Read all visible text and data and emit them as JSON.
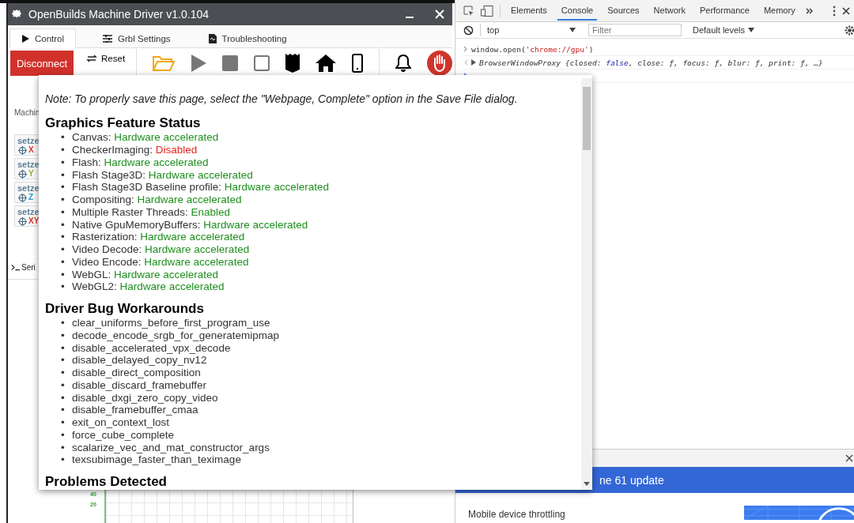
{
  "app_window": {
    "title": "OpenBuilds Machine Driver v1.0.104",
    "tabs": [
      {
        "label": "Control",
        "selected": true
      },
      {
        "label": "Grbl Settings",
        "selected": false
      },
      {
        "label": "Troubleshooting",
        "selected": false
      }
    ],
    "toolbar": {
      "disconnect": "Disconnect",
      "reset": "Reset"
    },
    "panel_tab": "Machin",
    "setzero_buttons": [
      {
        "label": "setze",
        "axis": "X",
        "color": "#d9342b"
      },
      {
        "label": "setze",
        "axis": "Y",
        "color": "#8cb22e"
      },
      {
        "label": "setze",
        "axis": "Z",
        "color": "#1f9fdc"
      },
      {
        "label": "setze",
        "axis": "XY",
        "color": "#d9342b"
      }
    ],
    "console_tab": "Seri",
    "axis_labels": [
      "40",
      "20"
    ]
  },
  "gpu_popup": {
    "note": "Note: To properly save this page, select the \"Webpage, Complete\" option in the Save File dialog.",
    "sections": [
      {
        "heading": "Graphics Feature Status",
        "bullet": "•",
        "items": [
          {
            "name": "Canvas: ",
            "status": "Hardware accelerated",
            "kind": "enabled"
          },
          {
            "name": "CheckerImaging: ",
            "status": "Disabled",
            "kind": "disabled"
          },
          {
            "name": "Flash: ",
            "status": "Hardware accelerated",
            "kind": "enabled"
          },
          {
            "name": "Flash Stage3D: ",
            "status": "Hardware accelerated",
            "kind": "enabled"
          },
          {
            "name": "Flash Stage3D Baseline profile: ",
            "status": "Hardware accelerated",
            "kind": "enabled"
          },
          {
            "name": "Compositing: ",
            "status": "Hardware accelerated",
            "kind": "enabled"
          },
          {
            "name": "Multiple Raster Threads: ",
            "status": "Enabled",
            "kind": "enabled"
          },
          {
            "name": "Native GpuMemoryBuffers: ",
            "status": "Hardware accelerated",
            "kind": "enabled"
          },
          {
            "name": "Rasterization: ",
            "status": "Hardware accelerated",
            "kind": "enabled"
          },
          {
            "name": "Video Decode: ",
            "status": "Hardware accelerated",
            "kind": "enabled"
          },
          {
            "name": "Video Encode: ",
            "status": "Hardware accelerated",
            "kind": "enabled"
          },
          {
            "name": "WebGL: ",
            "status": "Hardware accelerated",
            "kind": "enabled"
          },
          {
            "name": "WebGL2: ",
            "status": "Hardware accelerated",
            "kind": "enabled"
          }
        ]
      },
      {
        "heading": "Driver Bug Workarounds",
        "bullet": "•",
        "items": [
          {
            "name": "clear_uniforms_before_first_program_use"
          },
          {
            "name": "decode_encode_srgb_for_generatemipmap"
          },
          {
            "name": "disable_accelerated_vpx_decode"
          },
          {
            "name": "disable_delayed_copy_nv12"
          },
          {
            "name": "disable_direct_composition"
          },
          {
            "name": "disable_discard_framebuffer"
          },
          {
            "name": "disable_dxgi_zero_copy_video"
          },
          {
            "name": "disable_framebuffer_cmaa"
          },
          {
            "name": "exit_on_context_lost"
          },
          {
            "name": "force_cube_complete"
          },
          {
            "name": "scalarize_vec_and_mat_constructor_args"
          },
          {
            "name": "texsubimage_faster_than_teximage"
          }
        ]
      },
      {
        "heading": "Problems Detected"
      }
    ]
  },
  "devtools": {
    "tabs": [
      {
        "label": "Elements",
        "selected": false
      },
      {
        "label": "Console",
        "selected": true
      },
      {
        "label": "Sources",
        "selected": false
      },
      {
        "label": "Network",
        "selected": false
      },
      {
        "label": "Performance",
        "selected": false
      },
      {
        "label": "Memory",
        "selected": false
      }
    ],
    "context": "top",
    "filter_placeholder": "Filter",
    "levels": "Default levels",
    "console_lines": [
      {
        "kind": "input",
        "segments": [
          {
            "text": "window.open(",
            "kind": "code"
          },
          {
            "text": "'chrome://gpu'",
            "kind": "string"
          },
          {
            "text": ")",
            "kind": "code"
          }
        ]
      },
      {
        "kind": "output",
        "segments": [
          {
            "text": "BrowserWindowProxy {closed: ",
            "kind": "code"
          },
          {
            "text": "false",
            "kind": "keyword"
          },
          {
            "text": ", close: ƒ, focus: ƒ, blur: ƒ, print: ƒ, …}",
            "kind": "code"
          }
        ]
      }
    ],
    "drawer": {
      "banner": "ne 61 update",
      "card_title": "Mobile device throttling"
    }
  }
}
